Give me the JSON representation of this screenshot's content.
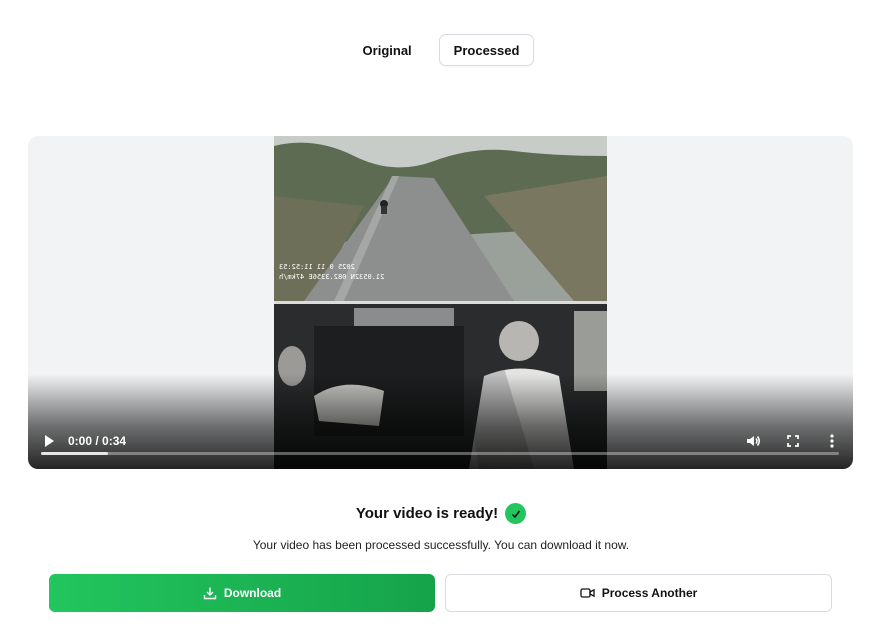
{
  "tabs": [
    {
      "label": "Original",
      "active": false
    },
    {
      "label": "Processed",
      "active": true
    }
  ],
  "player": {
    "time": "0:00 / 0:34",
    "progress_buffered": 0.084,
    "overlay_line1": "2025 0 11 11:52:53",
    "overlay_line2": "21.0532N 082.3356E 47km/h"
  },
  "result": {
    "title": "Your video is ready!",
    "subtitle": "Your video has been processed successfully. You can download it now."
  },
  "actions": {
    "download_label": "Download",
    "process_another_label": "Process Another"
  },
  "colors": {
    "accent_green": "#22c55e",
    "accent_green_dark": "#16a34a",
    "border": "#d9dbe0"
  },
  "icons": {
    "check": "check-icon",
    "download": "download-icon",
    "process_another": "video-camera-icon"
  }
}
